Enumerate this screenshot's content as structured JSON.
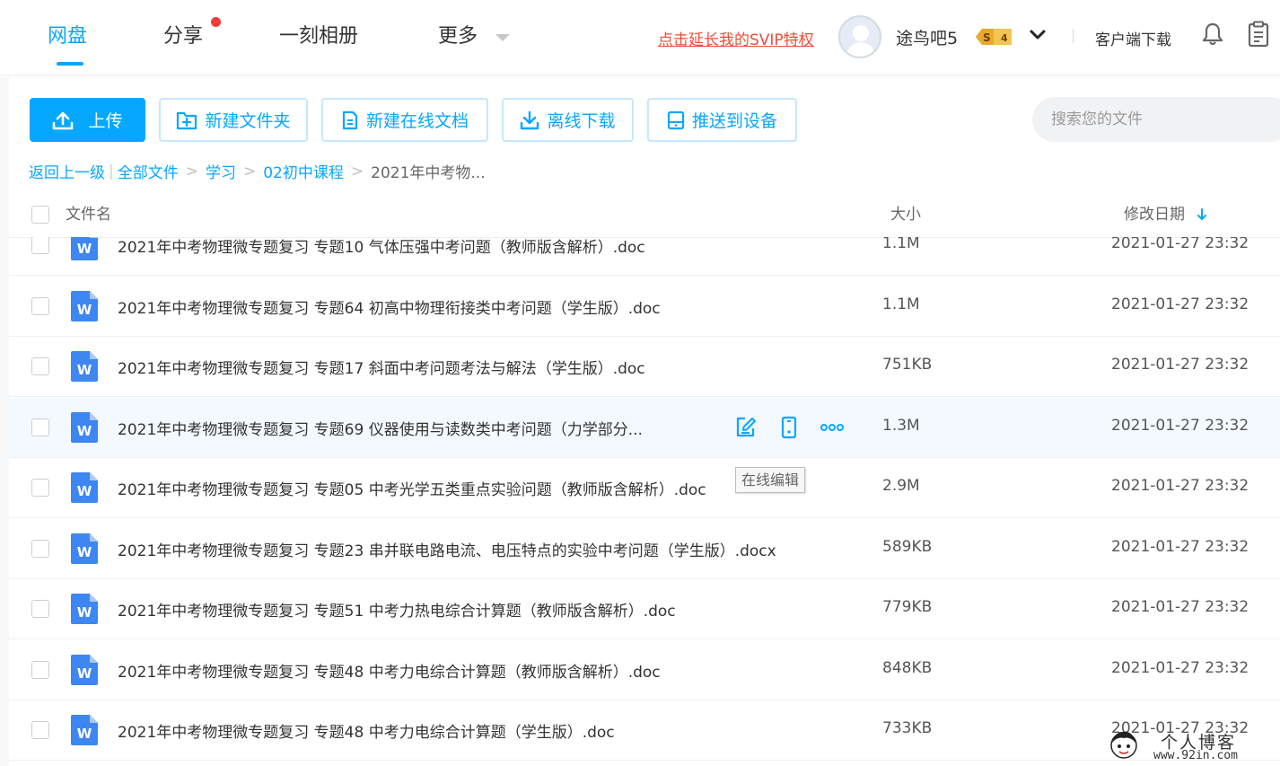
{
  "nav": {
    "tabs": [
      {
        "label": "网盘",
        "active": true
      },
      {
        "label": "分享",
        "has_dot": true
      },
      {
        "label": "一刻相册"
      },
      {
        "label": "更多",
        "has_caret": true
      }
    ]
  },
  "header": {
    "svip_link": "点击延长我的SVIP特权",
    "username": "途鸟吧5",
    "vip_level": "4",
    "client_download": "客户端下载"
  },
  "toolbar": {
    "upload": "上传",
    "new_folder": "新建文件夹",
    "new_online_doc": "新建在线文档",
    "offline_download": "离线下载",
    "push_to_device": "推送到设备",
    "search_placeholder": "搜索您的文件"
  },
  "breadcrumb": {
    "back": "返回上一级",
    "items": [
      "全部文件",
      "学习",
      "02初中课程"
    ],
    "current": "2021年中考物..."
  },
  "table": {
    "col_name": "文件名",
    "col_size": "大小",
    "col_date": "修改日期",
    "rows": [
      {
        "name": "2021年中考物理微专题复习 专题10 气体压强中考问题（教师版含解析）.doc",
        "size": "1.1M",
        "date": "2021-01-27 23:32"
      },
      {
        "name": "2021年中考物理微专题复习 专题64 初高中物理衔接类中考问题（学生版）.doc",
        "size": "1.1M",
        "date": "2021-01-27 23:32"
      },
      {
        "name": "2021年中考物理微专题复习 专题17 斜面中考问题考法与解法（学生版）.doc",
        "size": "751KB",
        "date": "2021-01-27 23:32"
      },
      {
        "name": "2021年中考物理微专题复习 专题69 仪器使用与读数类中考问题（力学部分...",
        "size": "1.3M",
        "date": "2021-01-27 23:32",
        "hover": true
      },
      {
        "name": "2021年中考物理微专题复习 专题05 中考光学五类重点实验问题（教师版含解析）.doc",
        "size": "2.9M",
        "date": "2021-01-27 23:32"
      },
      {
        "name": "2021年中考物理微专题复习 专题23 串并联电路电流、电压特点的实验中考问题（学生版）.docx",
        "size": "589KB",
        "date": "2021-01-27 23:32"
      },
      {
        "name": "2021年中考物理微专题复习 专题51 中考力热电综合计算题（教师版含解析）.doc",
        "size": "779KB",
        "date": "2021-01-27 23:32"
      },
      {
        "name": "2021年中考物理微专题复习 专题48 中考力电综合计算题（教师版含解析）.doc",
        "size": "848KB",
        "date": "2021-01-27 23:32"
      },
      {
        "name": "2021年中考物理微专题复习 专题48 中考力电综合计算题（学生版）.doc",
        "size": "733KB",
        "date": "2021-01-27 23:32"
      }
    ]
  },
  "tooltip": "在线编辑",
  "row_actions": [
    "edit-online-icon",
    "phone-icon",
    "more-icon"
  ],
  "file_icon": "word-doc-icon",
  "watermark": {
    "title": "个人博客",
    "url": "www.92in.com"
  },
  "colors": {
    "accent": "#06a7ff",
    "svip_link": "#f24b37",
    "word_icon": "#3e86f1",
    "hover_row": "#f3f9ff"
  }
}
